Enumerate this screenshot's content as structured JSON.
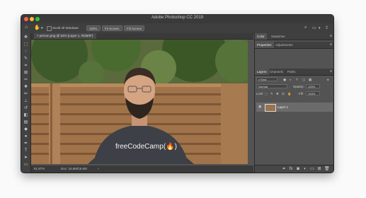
{
  "window": {
    "title": "Adobe Photoshop CC 2019"
  },
  "options_bar": {
    "scroll_all": "Scroll All Windows",
    "zoom": "100%",
    "fit_screen": "Fit Screen",
    "fill_screen": "Fill Screen"
  },
  "document": {
    "tab_title": "person.png @ 62% (Layer 1, RGB/8*)",
    "tshirt_text": "freeCodeCamp(🔥)"
  },
  "status": {
    "zoom": "61.87%",
    "doc": "Doc: 15.6M/15.6M"
  },
  "panels": {
    "top_tabs": [
      "Color",
      "Swatches"
    ],
    "mid_tabs": [
      "Properties",
      "Adjustments"
    ],
    "layers_tabs": [
      "Layers",
      "Channels",
      "Paths"
    ],
    "kind": "Kind",
    "blend": "Normal",
    "opacity_label": "Opacity:",
    "opacity": "100%",
    "lock_label": "Lock:",
    "fill_label": "Fill:",
    "fill": "100%",
    "layer_name": "Layer 1"
  },
  "colors": {
    "panel_bg": "#535353",
    "dark_bar": "#3a3a3a",
    "wood": "#a0734a"
  }
}
